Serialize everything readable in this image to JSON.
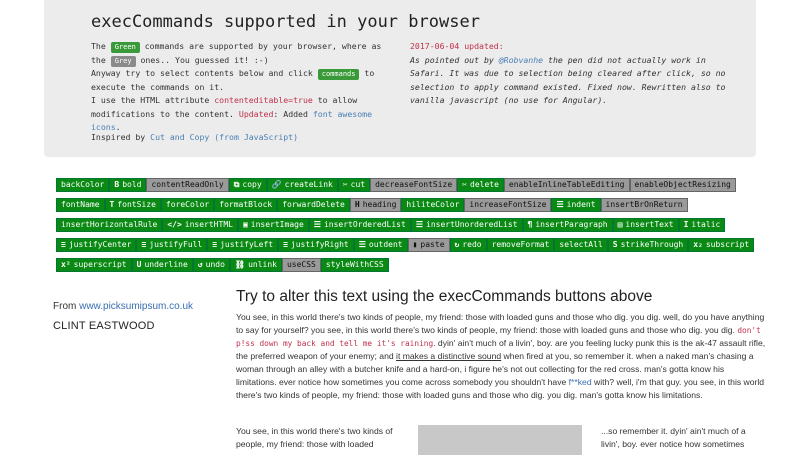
{
  "header": {
    "title": "execCommands supported in your browser",
    "left": {
      "l1_pre": "The ",
      "green_tag": "Green",
      "l1_mid": " commands are supported by your browser, where as the ",
      "grey_tag": "Grey",
      "l1_post": " ones.. You guessed it! :-)",
      "l2_pre": "Anyway try to select contents below and click ",
      "commands_tag": "commands",
      "l2_post": " to execute the commands on it.",
      "l3_pre": "I use the HTML attribute ",
      "attr_code": "contenteditable=true",
      "l3_post": " to allow modifications to the content. ",
      "updated_label": "Updated",
      "l3_tail": ": Added ",
      "fa_link": "font awesome icons",
      "l3_end": "."
    },
    "right": {
      "date": "2017-06-04 updated:",
      "r_pre": "As pointed out by ",
      "r_link": "@Robvanhe",
      "r_text": " the pen did not actually work in Safari. It was due to selection being cleared after click, so no selection to apply command existed. Fixed now. Rewritten also to vanilla javascript (no use for Angular)."
    },
    "inspired_pre": "Inspired by ",
    "inspired_link": "Cut and Copy (from JavaScript)"
  },
  "buttons": [
    {
      "label": "backColor",
      "icon": "",
      "state": "green"
    },
    {
      "label": "bold",
      "icon": "B",
      "state": "green"
    },
    {
      "label": "contentReadOnly",
      "icon": "",
      "state": "grey"
    },
    {
      "label": "copy",
      "icon": "⧉",
      "state": "green"
    },
    {
      "label": "createLink",
      "icon": "🔗",
      "state": "green"
    },
    {
      "label": "cut",
      "icon": "✂",
      "state": "green"
    },
    {
      "label": "decreaseFontSize",
      "icon": "",
      "state": "grey"
    },
    {
      "label": "delete",
      "icon": "✂",
      "state": "green"
    },
    {
      "label": "enableInlineTableEditing",
      "icon": "",
      "state": "grey"
    },
    {
      "label": "enableObjectResizing",
      "icon": "",
      "state": "grey"
    },
    {
      "label": "fontName",
      "icon": "",
      "state": "green"
    },
    {
      "label": "fontSize",
      "icon": "T",
      "state": "green"
    },
    {
      "label": "foreColor",
      "icon": "",
      "state": "green"
    },
    {
      "label": "formatBlock",
      "icon": "",
      "state": "green"
    },
    {
      "label": "forwardDelete",
      "icon": "",
      "state": "green"
    },
    {
      "label": "heading",
      "icon": "H",
      "state": "grey"
    },
    {
      "label": "hiliteColor",
      "icon": "",
      "state": "green"
    },
    {
      "label": "increaseFontSize",
      "icon": "",
      "state": "grey"
    },
    {
      "label": "indent",
      "icon": "☰",
      "state": "green"
    },
    {
      "label": "insertBrOnReturn",
      "icon": "",
      "state": "grey"
    },
    {
      "label": "insertHorizontalRule",
      "icon": "",
      "state": "green"
    },
    {
      "label": "insertHTML",
      "icon": "</>",
      "state": "green"
    },
    {
      "label": "insertImage",
      "icon": "▣",
      "state": "green"
    },
    {
      "label": "insertOrderedList",
      "icon": "☰",
      "state": "green"
    },
    {
      "label": "insertUnorderedList",
      "icon": "☰",
      "state": "green"
    },
    {
      "label": "insertParagraph",
      "icon": "¶",
      "state": "green"
    },
    {
      "label": "insertText",
      "icon": "▤",
      "state": "green"
    },
    {
      "label": "italic",
      "icon": "I",
      "state": "green"
    },
    {
      "label": "justifyCenter",
      "icon": "≡",
      "state": "green"
    },
    {
      "label": "justifyFull",
      "icon": "≡",
      "state": "green"
    },
    {
      "label": "justifyLeft",
      "icon": "≡",
      "state": "green"
    },
    {
      "label": "justifyRight",
      "icon": "≡",
      "state": "green"
    },
    {
      "label": "outdent",
      "icon": "☰",
      "state": "green"
    },
    {
      "label": "paste",
      "icon": "▮",
      "state": "grey"
    },
    {
      "label": "redo",
      "icon": "↻",
      "state": "green"
    },
    {
      "label": "removeFormat",
      "icon": "",
      "state": "green"
    },
    {
      "label": "selectAll",
      "icon": "",
      "state": "green"
    },
    {
      "label": "strikeThrough",
      "icon": "S",
      "state": "green"
    },
    {
      "label": "subscript",
      "icon": "x₂",
      "state": "green"
    },
    {
      "label": "superscript",
      "icon": "x²",
      "state": "green"
    },
    {
      "label": "underline",
      "icon": "U",
      "state": "green"
    },
    {
      "label": "undo",
      "icon": "↺",
      "state": "green"
    },
    {
      "label": "unlink",
      "icon": "⛓",
      "state": "green"
    },
    {
      "label": "useCSS",
      "icon": "",
      "state": "grey"
    },
    {
      "label": "styleWithCSS",
      "icon": "",
      "state": "green"
    }
  ],
  "sidebar": {
    "from_pre": "From ",
    "from_link": "www.picksumipsum.co.uk",
    "author": "CLINT EASTWOOD"
  },
  "content": {
    "title": "Try to alter this text using the execCommands buttons above",
    "p1": "You see, in this world there's two kinds of people, my friend: those with loaded guns and those who dig. you dig. well, do you have anything to say for yourself? you see, in this world there's two kinds of people, my friend: those with loaded guns and those who dig. you dig. ",
    "p1_code": "don't p!ss down my back and tell me it's raining",
    "p2": ". dyin' ain't much of a livin', boy. are you feeling lucky punk this is the ak-47 assault rifle, the preferred weapon of your enemy; and ",
    "p2_und": "it makes a distinctive sound",
    "p3": " when fired at you, so remember it. when a naked man's chasing a woman through an alley with a butcher knife and a hard-on, i figure he's not out collecting for the red cross. man's gotta know his limitations. ever notice how sometimes you come across somebody you shouldn't have ",
    "p3_link": "f**ked",
    "p4": " with? well, i'm that guy. you see, in this world there's two kinds of people, my friend: those with loaded guns and those who dig. you dig. man's gotta know his limitations.",
    "col_left": "You see, in this world there's two kinds of people, my friend: those with loaded",
    "col_right": "...so remember it. dyin' ain't much of a livin', boy. ever notice how sometimes"
  },
  "colors": {
    "enabled": "#0a8a14",
    "disabled": "#9a9a9a",
    "accent_red": "#c0304a",
    "link": "#3a6fb0"
  }
}
